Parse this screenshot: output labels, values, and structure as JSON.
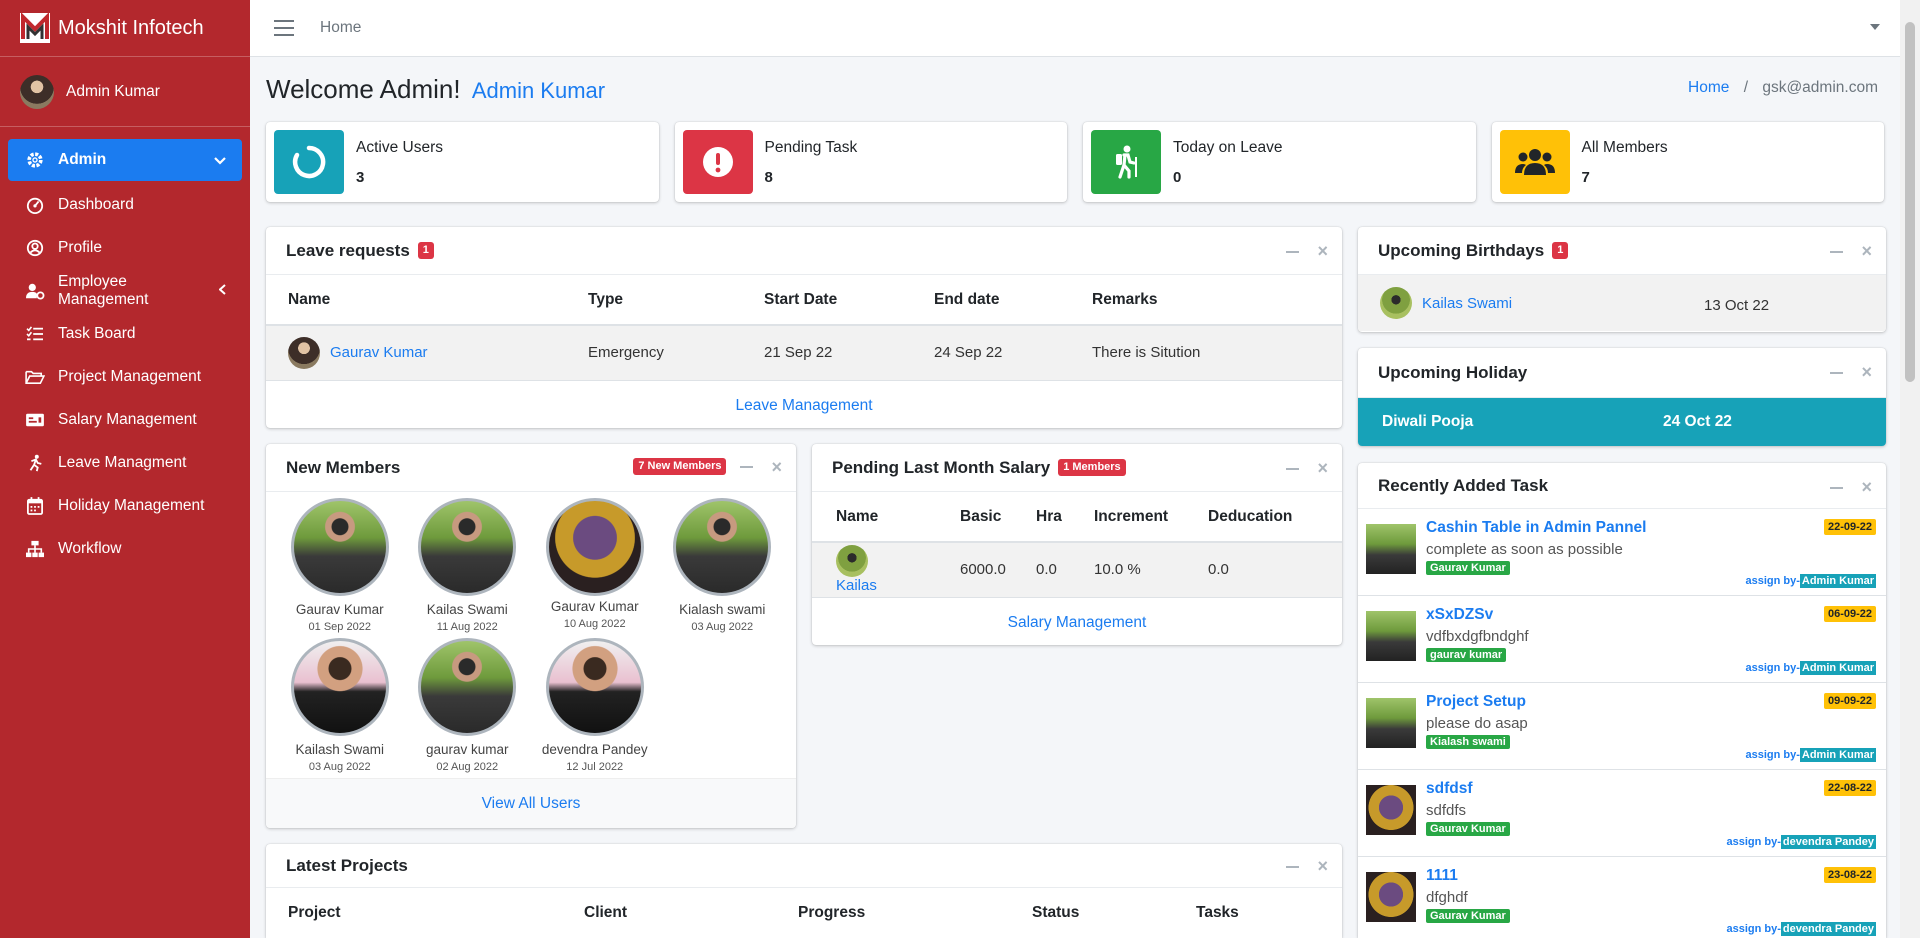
{
  "brand": {
    "name": "Mokshit Infotech"
  },
  "user": {
    "name": "Admin Kumar"
  },
  "sidebar": {
    "items": [
      {
        "label": "Admin",
        "icon": "gear-icon"
      },
      {
        "label": "Dashboard",
        "icon": "gauge-icon"
      },
      {
        "label": "Profile",
        "icon": "user-circle-icon"
      },
      {
        "label": "Employee Management",
        "icon": "user-gear-icon"
      },
      {
        "label": "Task Board",
        "icon": "list-check-icon"
      },
      {
        "label": "Project Management",
        "icon": "folder-open-icon"
      },
      {
        "label": "Salary Management",
        "icon": "money-check-icon"
      },
      {
        "label": "Leave Managment",
        "icon": "running-person-icon"
      },
      {
        "label": "Holiday Management",
        "icon": "calendar-icon"
      },
      {
        "label": "Workflow",
        "icon": "sitemap-icon"
      }
    ]
  },
  "topbar": {
    "home": "Home"
  },
  "page": {
    "welcome": "Welcome Admin!",
    "user_name": "Admin Kumar",
    "breadcrumb_home": "Home",
    "breadcrumb_sep": "/",
    "breadcrumb_current": "gsk@admin.com"
  },
  "stats": [
    {
      "label": "Active Users",
      "value": "3",
      "color": "#17a2b8",
      "icon": "circle-notch-icon"
    },
    {
      "label": "Pending Task",
      "value": "8",
      "color": "#dc3545",
      "icon": "exclamation-circle-icon"
    },
    {
      "label": "Today on Leave",
      "value": "0",
      "color": "#28a745",
      "icon": "hiking-icon"
    },
    {
      "label": "All Members",
      "value": "7",
      "color": "#ffc107",
      "icon": "users-icon"
    }
  ],
  "leave": {
    "title": "Leave requests",
    "badge": "1",
    "headers": [
      "Name",
      "Type",
      "Start Date",
      "End date",
      "Remarks"
    ],
    "rows": [
      {
        "name": "Gaurav Kumar",
        "type": "Emergency",
        "start": "21 Sep 22",
        "end": "24 Sep 22",
        "remarks": "There is Sitution"
      }
    ],
    "footer": "Leave Management"
  },
  "birthdays": {
    "title": "Upcoming Birthdays",
    "badge": "1",
    "items": [
      {
        "name": "Kailas Swami",
        "date": "13 Oct 22"
      }
    ]
  },
  "holiday": {
    "title": "Upcoming Holiday",
    "name": "Diwali Pooja",
    "date": "24 Oct 22"
  },
  "members": {
    "title": "New Members",
    "badge": "7 New Members",
    "items": [
      {
        "name": "Gaurav Kumar",
        "date": "01 Sep 2022"
      },
      {
        "name": "Kailas Swami",
        "date": "11 Aug 2022"
      },
      {
        "name": "Gaurav Kumar",
        "date": "10 Aug 2022"
      },
      {
        "name": "Kialash swami",
        "date": "03 Aug 2022"
      },
      {
        "name": "Kailash Swami",
        "date": "03 Aug 2022"
      },
      {
        "name": "gaurav kumar",
        "date": "02 Aug 2022"
      },
      {
        "name": "devendra Pandey",
        "date": "12 Jul 2022"
      }
    ],
    "footer": "View All Users"
  },
  "salary": {
    "title": "Pending Last Month Salary",
    "badge": "1 Members",
    "headers": [
      "Name",
      "Basic",
      "Hra",
      "Increment",
      "Deducation"
    ],
    "rows": [
      {
        "name": "Kailas",
        "basic": "6000.0",
        "hra": "0.0",
        "increment": "10.0 %",
        "deduction": "0.0"
      }
    ],
    "footer": "Salary Management"
  },
  "tasks": {
    "title": "Recently Added Task",
    "assign_prefix": "assign by-",
    "items": [
      {
        "title": "Cashin Table in Admin Pannel",
        "desc": "complete as soon as possible",
        "user": "Gaurav Kumar",
        "date": "22-09-22",
        "by": "Admin Kumar"
      },
      {
        "title": "xSxDZSv",
        "desc": "vdfbxdgfbndghf",
        "user": "gaurav kumar",
        "date": "06-09-22",
        "by": "Admin Kumar"
      },
      {
        "title": "Project Setup",
        "desc": "please do asap",
        "user": "Kialash swami",
        "date": "09-09-22",
        "by": "Admin Kumar"
      },
      {
        "title": "sdfdsf",
        "desc": "sdfdfs",
        "user": "Gaurav Kumar",
        "date": "22-08-22",
        "by": "devendra Pandey"
      },
      {
        "title": "1111",
        "desc": "dfghdf",
        "user": "Gaurav Kumar",
        "date": "23-08-22",
        "by": "devendra Pandey"
      }
    ]
  },
  "projects": {
    "title": "Latest Projects",
    "headers": [
      "Project",
      "Client",
      "Progress",
      "Status",
      "Tasks"
    ]
  }
}
